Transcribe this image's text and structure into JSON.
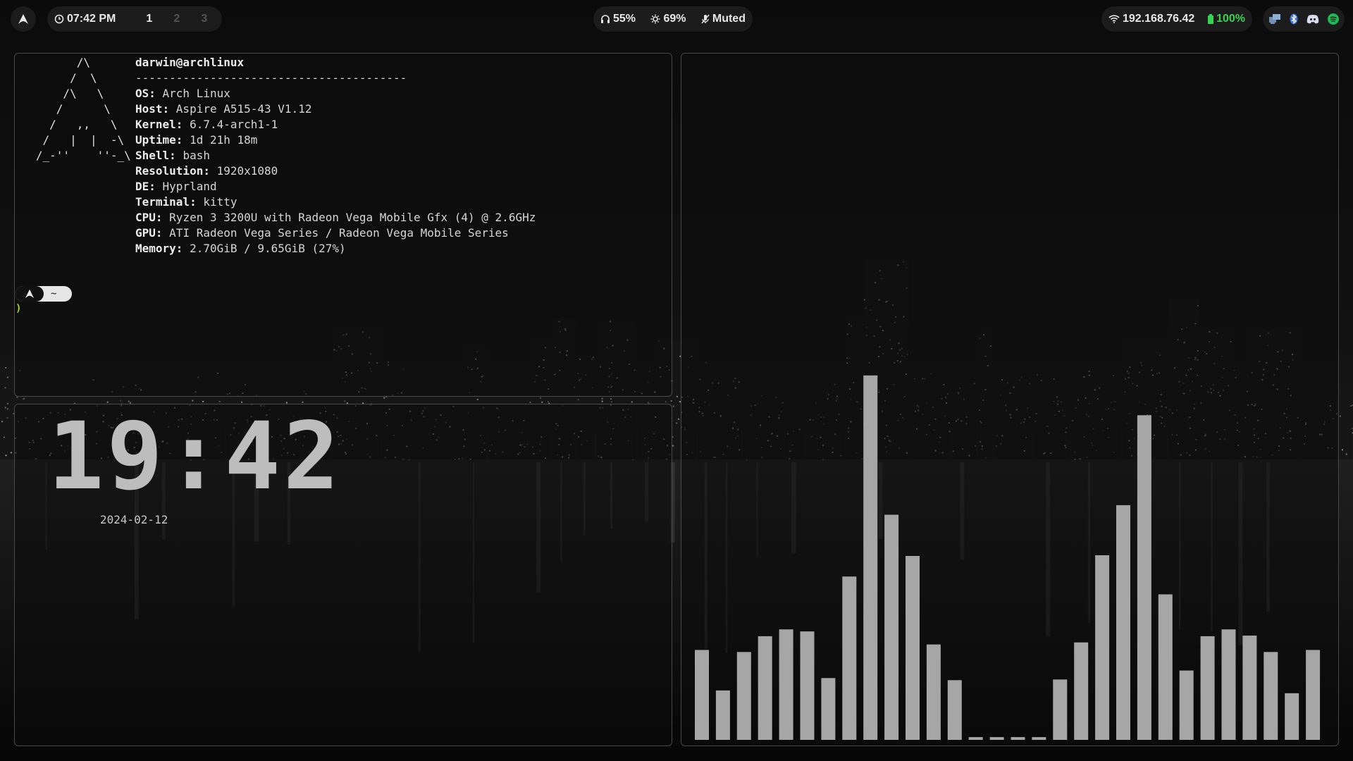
{
  "colors": {
    "bar_bg": "#1c1c1c",
    "accent_green": "#39d353",
    "spotify_green": "#1db954",
    "border": "#4a4a4a",
    "bars": "#a6a6a6"
  },
  "topbar": {
    "launcher_icon": "arch-logo-icon",
    "time": "07:42 PM",
    "workspaces": [
      {
        "label": "1",
        "active": true
      },
      {
        "label": "2",
        "active": false
      },
      {
        "label": "3",
        "active": false
      }
    ],
    "volume": "55%",
    "brightness": "69%",
    "mic": "Muted",
    "ip": "192.168.76.42",
    "battery": "100%",
    "tray_icons": [
      "network-manager-icon",
      "bluetooth-icon",
      "discord-icon",
      "spotify-icon"
    ]
  },
  "neofetch": {
    "user_host": "darwin@archlinux",
    "separator": "----------------------------------------",
    "ascii": "         /\\\n        /  \\\n       /\\   \\\n      /      \\\n     /   ,,   \\\n    /   |  |  -\\\n   /_-''    ''-_\\",
    "rows": [
      {
        "key": "OS",
        "value": "Arch Linux"
      },
      {
        "key": "Host",
        "value": "Aspire A515-43 V1.12"
      },
      {
        "key": "Kernel",
        "value": "6.7.4-arch1-1"
      },
      {
        "key": "Uptime",
        "value": "1d 21h 18m"
      },
      {
        "key": "Shell",
        "value": "bash"
      },
      {
        "key": "Resolution",
        "value": "1920x1080"
      },
      {
        "key": "DE",
        "value": "Hyprland"
      },
      {
        "key": "Terminal",
        "value": "kitty"
      },
      {
        "key": "CPU",
        "value": "Ryzen 3 3200U with Radeon Vega Mobile Gfx (4) @ 2.6GHz"
      },
      {
        "key": "GPU",
        "value": "ATI Radeon Vega Series / Radeon Vega Mobile Series"
      },
      {
        "key": "Memory",
        "value": "2.70GiB / 9.65GiB (27%)"
      }
    ],
    "prompt_dir": "~",
    "prompt_cursor": ")"
  },
  "clock": {
    "time": "19:42",
    "date": "2024-02-12"
  },
  "visualizer": {
    "levels": [
      0.131,
      0.072,
      0.128,
      0.151,
      0.161,
      0.158,
      0.09,
      0.238,
      0.531,
      0.328,
      0.268,
      0.139,
      0.087,
      0.004,
      0.004,
      0.004,
      0.004,
      0.088,
      0.142,
      0.269,
      0.342,
      0.473,
      0.212,
      0.101,
      0.151,
      0.161,
      0.152,
      0.128,
      0.068,
      0.131
    ]
  }
}
